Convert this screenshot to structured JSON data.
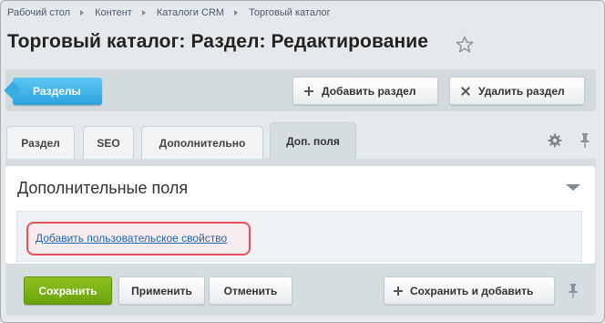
{
  "breadcrumb": [
    "Рабочий стол",
    "Контент",
    "Каталоги CRM",
    "Торговый каталог"
  ],
  "page_title": "Торговый каталог: Раздел: Редактирование",
  "toolbar": {
    "sections_label": "Разделы",
    "add_section_label": "Добавить раздел",
    "delete_section_label": "Удалить раздел"
  },
  "tabs": [
    {
      "label": "Раздел"
    },
    {
      "label": "SEO"
    },
    {
      "label": "Дополнительно"
    },
    {
      "label": "Доп. поля",
      "active": true
    }
  ],
  "section": {
    "title": "Дополнительные поля",
    "add_property_link": "Добавить пользовательское свойство"
  },
  "footer": {
    "save_label": "Сохранить",
    "apply_label": "Применить",
    "cancel_label": "Отменить",
    "save_and_add_label": "Сохранить и добавить"
  },
  "colors": {
    "accent_blue": "#2aa4de",
    "save_green": "#6aa30c",
    "highlight_red": "#e8505b",
    "link": "#2067b0"
  },
  "icons": [
    "star-icon",
    "plus-icon",
    "close-icon",
    "gear-icon",
    "pin-icon",
    "chevron-down-icon"
  ]
}
